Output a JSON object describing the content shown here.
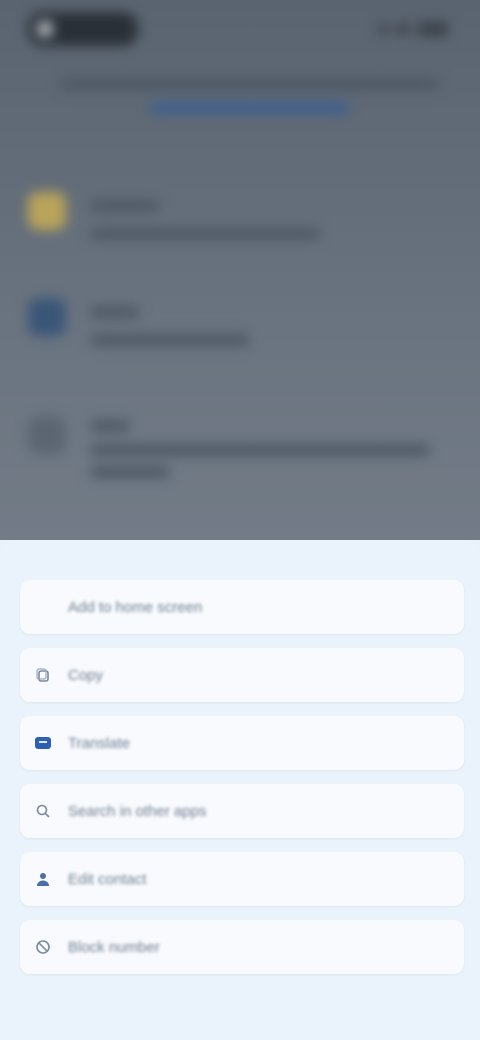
{
  "background_screen": {
    "description_hidden": true,
    "accent_color": "#2a3038"
  },
  "sheet": {
    "items": [
      {
        "label": "Add to home screen",
        "icon": "blank-icon"
      },
      {
        "label": "Copy",
        "icon": "copy-icon"
      },
      {
        "label": "Translate",
        "icon": "translate-icon"
      },
      {
        "label": "Search in other apps",
        "icon": "search-icon"
      },
      {
        "label": "Edit contact",
        "icon": "person-icon"
      },
      {
        "label": "Block number",
        "icon": "block-icon"
      }
    ],
    "colors": {
      "sheet_bg": "#eaf2fc",
      "item_bg": "#f8fafd",
      "accent": "#2f5fb3",
      "text": "#6f7f92"
    }
  }
}
